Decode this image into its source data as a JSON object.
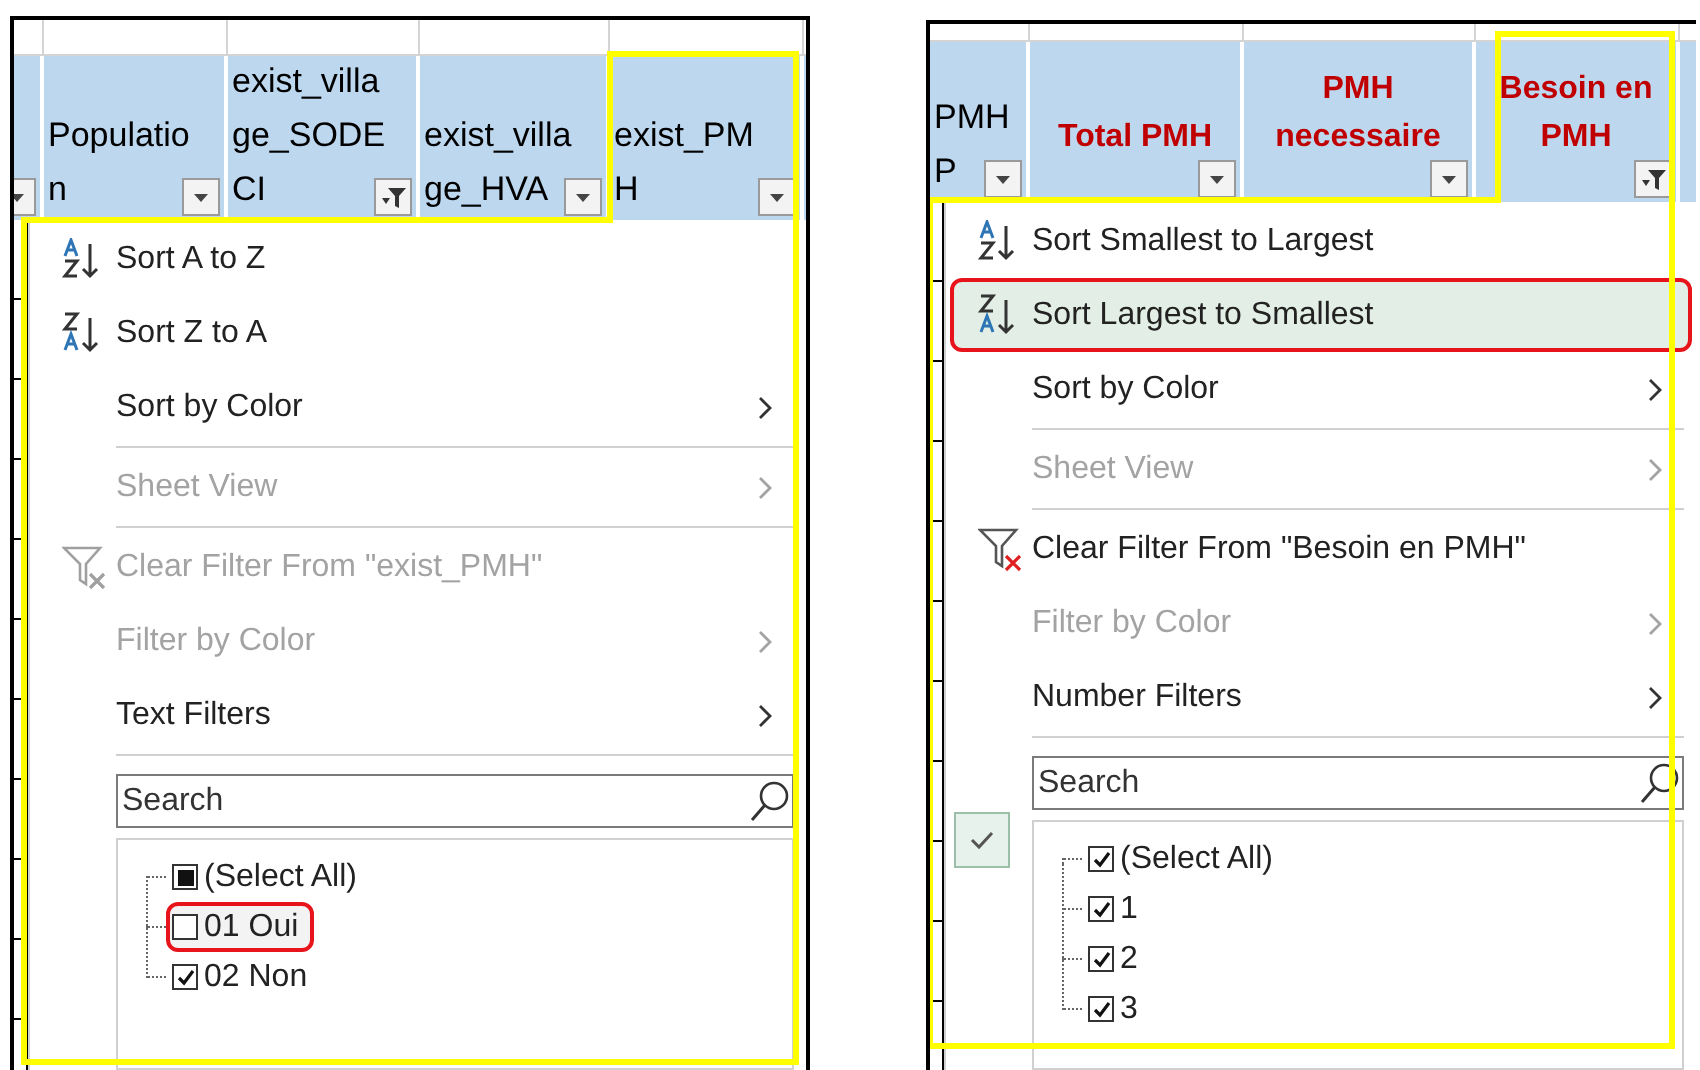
{
  "panels": [
    {
      "columns": [
        {
          "filtered": false
        },
        {
          "lines": [
            "Populatio",
            "n"
          ],
          "filtered": false,
          "highlighted": false
        },
        {
          "lines": [
            "exist_villa",
            "ge_SODE",
            "CI"
          ],
          "filtered": true,
          "highlighted": false
        },
        {
          "lines": [
            "exist_villa",
            "ge_HVA"
          ],
          "filtered": false,
          "highlighted": false
        },
        {
          "lines": [
            "exist_PM",
            "H"
          ],
          "filtered": false,
          "highlighted": false
        }
      ],
      "menu": {
        "items": [
          {
            "kind": "sort_ascending",
            "label": "Sort A to Z",
            "disabled": false,
            "highlighted": false,
            "annotated": false
          },
          {
            "kind": "sort_descending",
            "label": "Sort Z to A",
            "disabled": false,
            "highlighted": false,
            "annotated": false
          },
          {
            "kind": "submenu",
            "label": "Sort by Color",
            "disabled": false,
            "highlighted": false,
            "annotated": false
          },
          {
            "kind": "separator"
          },
          {
            "kind": "submenu",
            "label": "Sheet View",
            "disabled": true,
            "highlighted": false,
            "annotated": false
          },
          {
            "kind": "separator"
          },
          {
            "kind": "clear_filter",
            "label": "Clear Filter From \"exist_PMH\"",
            "disabled": true,
            "highlighted": false,
            "annotated": false
          },
          {
            "kind": "submenu",
            "label": "Filter by Color",
            "disabled": true,
            "highlighted": false,
            "annotated": false
          },
          {
            "kind": "submenu",
            "label": "Text Filters",
            "disabled": false,
            "highlighted": false,
            "annotated": false
          },
          {
            "kind": "separator"
          }
        ],
        "search": {
          "placeholder": "Search"
        },
        "values": [
          {
            "label": "(Select All)",
            "partial": true,
            "annotated": false
          },
          {
            "label": "01 Oui",
            "checked": false,
            "annotated": true
          },
          {
            "label": "02 Non",
            "checked": true,
            "annotated": false
          }
        ]
      }
    },
    {
      "columns": [
        {
          "lines": [
            "PMH",
            "P"
          ],
          "filtered": false,
          "highlighted": false
        },
        {
          "lines": [
            "Total PMH"
          ],
          "filtered": false,
          "highlighted": true
        },
        {
          "lines": [
            "PMH",
            "necessaire"
          ],
          "filtered": false,
          "highlighted": true
        },
        {
          "lines": [
            "Besoin en",
            "PMH"
          ],
          "filtered": true,
          "highlighted": true
        }
      ],
      "menu": {
        "items": [
          {
            "kind": "sort_ascending",
            "label": "Sort Smallest to Largest",
            "disabled": false,
            "highlighted": false,
            "annotated": false
          },
          {
            "kind": "sort_descending",
            "label": "Sort Largest to Smallest",
            "disabled": false,
            "highlighted": true,
            "annotated": true
          },
          {
            "kind": "submenu",
            "label": "Sort by Color",
            "disabled": false,
            "highlighted": false,
            "annotated": false
          },
          {
            "kind": "separator"
          },
          {
            "kind": "submenu",
            "label": "Sheet View",
            "disabled": true,
            "highlighted": false,
            "annotated": false
          },
          {
            "kind": "separator"
          },
          {
            "kind": "clear_filter",
            "label": "Clear Filter From \"Besoin en PMH\"",
            "disabled": false,
            "highlighted": false,
            "annotated": false
          },
          {
            "kind": "submenu",
            "label": "Filter by Color",
            "disabled": true,
            "highlighted": false,
            "annotated": false
          },
          {
            "kind": "submenu",
            "label": "Number Filters",
            "disabled": false,
            "highlighted": false,
            "annotated": false
          },
          {
            "kind": "separator"
          }
        ],
        "search": {
          "placeholder": "Search"
        },
        "side_check": true,
        "values": [
          {
            "label": "(Select All)",
            "checked": true,
            "annotated": false
          },
          {
            "label": "1",
            "checked": true,
            "annotated": false
          },
          {
            "label": "2",
            "checked": true,
            "annotated": false
          },
          {
            "label": "3",
            "checked": true,
            "annotated": false
          }
        ]
      }
    }
  ]
}
